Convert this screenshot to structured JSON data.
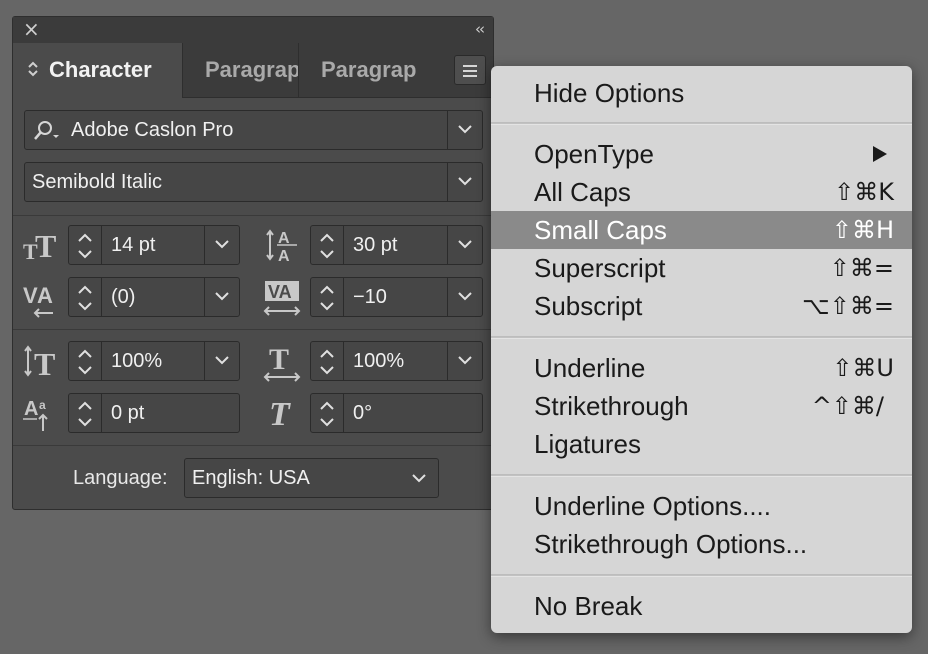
{
  "panel": {
    "tabs": [
      {
        "label": "Character"
      },
      {
        "label": "Paragraph"
      },
      {
        "label": "Paragraph Styles"
      }
    ],
    "font_family": "Adobe Caslon Pro",
    "font_style": "Semibold Italic",
    "font_size": "14 pt",
    "leading": "30 pt",
    "kerning": "(0)",
    "tracking": "−10",
    "vertical_scale": "100%",
    "horizontal_scale": "100%",
    "baseline_shift": "0 pt",
    "skew": "0°",
    "language_label": "Language:",
    "language": "English: USA"
  },
  "menu": {
    "hide_options": "Hide Options",
    "opentype": "OpenType",
    "all_caps": "All Caps",
    "all_caps_sc": "⇧⌘K",
    "small_caps": "Small Caps",
    "small_caps_sc": "⇧⌘H",
    "superscript": "Superscript",
    "superscript_sc": "⇧⌘=",
    "subscript": "Subscript",
    "subscript_sc": "⌥⇧⌘=",
    "underline": "Underline",
    "underline_sc": "⇧⌘U",
    "strikethrough": "Strikethrough",
    "strikethrough_sc": "^⇧⌘/",
    "ligatures": "Ligatures",
    "underline_options": "Underline Options....",
    "strikethrough_options": "Strikethrough Options...",
    "no_break": "No Break"
  },
  "colors": {
    "background": "#666666",
    "panel": "#4b4b4b",
    "menu": "#d6d6d6",
    "highlight": "#8a8a8a"
  }
}
